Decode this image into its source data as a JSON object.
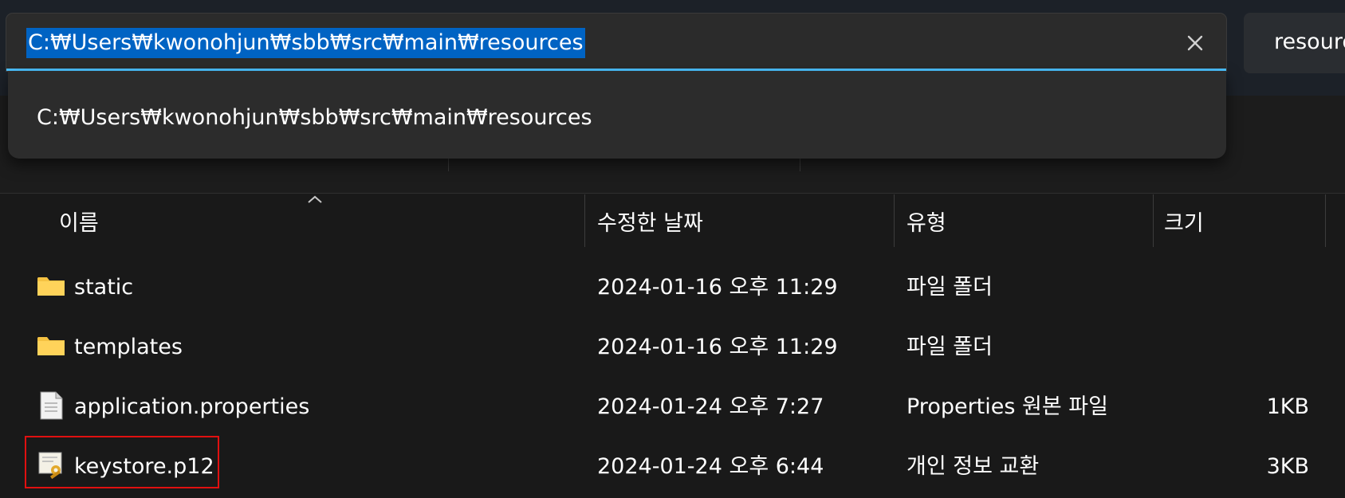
{
  "address_bar": {
    "path": "C:₩Users₩kwonohjun₩sbb₩src₩main₩resources",
    "suggestion": "C:₩Users₩kwonohjun₩sbb₩src₩main₩resources"
  },
  "search_box": {
    "text": "resources"
  },
  "columns": {
    "name": "이름",
    "date": "수정한 날짜",
    "type": "유형",
    "size": "크기"
  },
  "files": [
    {
      "name": "static",
      "date": "2024-01-16 오후 11:29",
      "type": "파일 폴더",
      "size": "",
      "icon": "folder-icon"
    },
    {
      "name": "templates",
      "date": "2024-01-16 오후 11:29",
      "type": "파일 폴더",
      "size": "",
      "icon": "folder-icon"
    },
    {
      "name": "application.properties",
      "date": "2024-01-24 오후 7:27",
      "type": "Properties 원본 파일",
      "size": "1KB",
      "icon": "document-icon"
    },
    {
      "name": "keystore.p12",
      "date": "2024-01-24 오후 6:44",
      "type": "개인 정보 교환",
      "size": "3KB",
      "icon": "certificate-icon"
    }
  ],
  "colors": {
    "selection": "#0063c3",
    "focus_underline": "#4cc2ff",
    "folder": "#f5c242",
    "annotation_box": "#e01010"
  }
}
